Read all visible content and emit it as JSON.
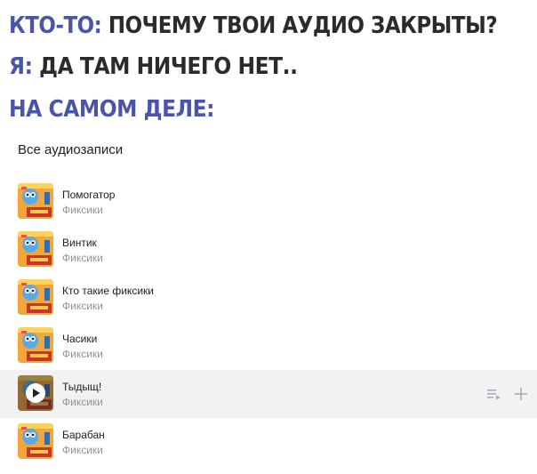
{
  "meme": {
    "line1": {
      "speaker": "КТО-ТО:",
      "text": "ПОЧЕМУ ТВОИ АУДИО ЗАКРЫТЫ?"
    },
    "line2": {
      "speaker": "Я:",
      "text": "ДА ТАМ НИЧЕГО НЕТ.."
    },
    "line3": {
      "text": "НА САМОМ ДЕЛЕ:"
    }
  },
  "playlist": {
    "section_title": "Все аудиозаписи",
    "tracks": [
      {
        "title": "Помогатор",
        "artist": "Фиксики"
      },
      {
        "title": "Винтик",
        "artist": "Фиксики"
      },
      {
        "title": "Кто такие фиксики",
        "artist": "Фиксики"
      },
      {
        "title": "Часики",
        "artist": "Фиксики"
      },
      {
        "title": "Тыдыщ!",
        "artist": "Фиксики"
      },
      {
        "title": "Барабан",
        "artist": "Фиксики"
      }
    ],
    "active_track_index": 4
  },
  "icons": {
    "play": "play-icon",
    "add_to_queue": "queue-icon",
    "add": "plus-icon"
  },
  "colors": {
    "accent": "#4a54a8",
    "text": "#2b2b2b",
    "secondary": "#939393",
    "row_highlight": "#f1f2f4"
  }
}
